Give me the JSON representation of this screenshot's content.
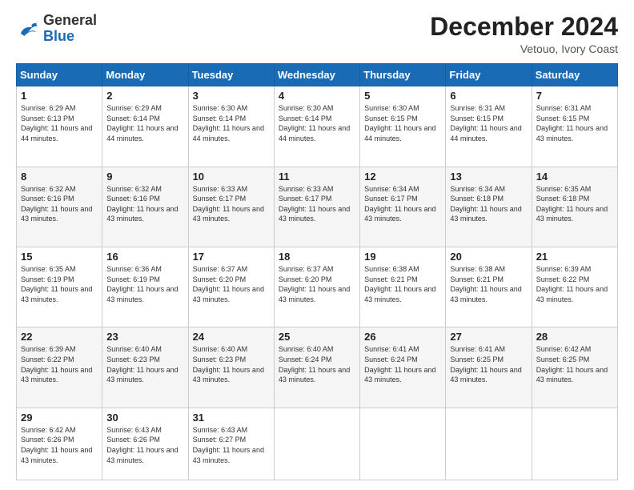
{
  "header": {
    "logo_general": "General",
    "logo_blue": "Blue",
    "month_title": "December 2024",
    "location": "Vetouo, Ivory Coast"
  },
  "days_of_week": [
    "Sunday",
    "Monday",
    "Tuesday",
    "Wednesday",
    "Thursday",
    "Friday",
    "Saturday"
  ],
  "weeks": [
    [
      {
        "day": "1",
        "sunrise": "6:29 AM",
        "sunset": "6:13 PM",
        "daylight": "11 hours and 44 minutes."
      },
      {
        "day": "2",
        "sunrise": "6:29 AM",
        "sunset": "6:14 PM",
        "daylight": "11 hours and 44 minutes."
      },
      {
        "day": "3",
        "sunrise": "6:30 AM",
        "sunset": "6:14 PM",
        "daylight": "11 hours and 44 minutes."
      },
      {
        "day": "4",
        "sunrise": "6:30 AM",
        "sunset": "6:14 PM",
        "daylight": "11 hours and 44 minutes."
      },
      {
        "day": "5",
        "sunrise": "6:30 AM",
        "sunset": "6:15 PM",
        "daylight": "11 hours and 44 minutes."
      },
      {
        "day": "6",
        "sunrise": "6:31 AM",
        "sunset": "6:15 PM",
        "daylight": "11 hours and 44 minutes."
      },
      {
        "day": "7",
        "sunrise": "6:31 AM",
        "sunset": "6:15 PM",
        "daylight": "11 hours and 43 minutes."
      }
    ],
    [
      {
        "day": "8",
        "sunrise": "6:32 AM",
        "sunset": "6:16 PM",
        "daylight": "11 hours and 43 minutes."
      },
      {
        "day": "9",
        "sunrise": "6:32 AM",
        "sunset": "6:16 PM",
        "daylight": "11 hours and 43 minutes."
      },
      {
        "day": "10",
        "sunrise": "6:33 AM",
        "sunset": "6:17 PM",
        "daylight": "11 hours and 43 minutes."
      },
      {
        "day": "11",
        "sunrise": "6:33 AM",
        "sunset": "6:17 PM",
        "daylight": "11 hours and 43 minutes."
      },
      {
        "day": "12",
        "sunrise": "6:34 AM",
        "sunset": "6:17 PM",
        "daylight": "11 hours and 43 minutes."
      },
      {
        "day": "13",
        "sunrise": "6:34 AM",
        "sunset": "6:18 PM",
        "daylight": "11 hours and 43 minutes."
      },
      {
        "day": "14",
        "sunrise": "6:35 AM",
        "sunset": "6:18 PM",
        "daylight": "11 hours and 43 minutes."
      }
    ],
    [
      {
        "day": "15",
        "sunrise": "6:35 AM",
        "sunset": "6:19 PM",
        "daylight": "11 hours and 43 minutes."
      },
      {
        "day": "16",
        "sunrise": "6:36 AM",
        "sunset": "6:19 PM",
        "daylight": "11 hours and 43 minutes."
      },
      {
        "day": "17",
        "sunrise": "6:37 AM",
        "sunset": "6:20 PM",
        "daylight": "11 hours and 43 minutes."
      },
      {
        "day": "18",
        "sunrise": "6:37 AM",
        "sunset": "6:20 PM",
        "daylight": "11 hours and 43 minutes."
      },
      {
        "day": "19",
        "sunrise": "6:38 AM",
        "sunset": "6:21 PM",
        "daylight": "11 hours and 43 minutes."
      },
      {
        "day": "20",
        "sunrise": "6:38 AM",
        "sunset": "6:21 PM",
        "daylight": "11 hours and 43 minutes."
      },
      {
        "day": "21",
        "sunrise": "6:39 AM",
        "sunset": "6:22 PM",
        "daylight": "11 hours and 43 minutes."
      }
    ],
    [
      {
        "day": "22",
        "sunrise": "6:39 AM",
        "sunset": "6:22 PM",
        "daylight": "11 hours and 43 minutes."
      },
      {
        "day": "23",
        "sunrise": "6:40 AM",
        "sunset": "6:23 PM",
        "daylight": "11 hours and 43 minutes."
      },
      {
        "day": "24",
        "sunrise": "6:40 AM",
        "sunset": "6:23 PM",
        "daylight": "11 hours and 43 minutes."
      },
      {
        "day": "25",
        "sunrise": "6:40 AM",
        "sunset": "6:24 PM",
        "daylight": "11 hours and 43 minutes."
      },
      {
        "day": "26",
        "sunrise": "6:41 AM",
        "sunset": "6:24 PM",
        "daylight": "11 hours and 43 minutes."
      },
      {
        "day": "27",
        "sunrise": "6:41 AM",
        "sunset": "6:25 PM",
        "daylight": "11 hours and 43 minutes."
      },
      {
        "day": "28",
        "sunrise": "6:42 AM",
        "sunset": "6:25 PM",
        "daylight": "11 hours and 43 minutes."
      }
    ],
    [
      {
        "day": "29",
        "sunrise": "6:42 AM",
        "sunset": "6:26 PM",
        "daylight": "11 hours and 43 minutes."
      },
      {
        "day": "30",
        "sunrise": "6:43 AM",
        "sunset": "6:26 PM",
        "daylight": "11 hours and 43 minutes."
      },
      {
        "day": "31",
        "sunrise": "6:43 AM",
        "sunset": "6:27 PM",
        "daylight": "11 hours and 43 minutes."
      },
      null,
      null,
      null,
      null
    ]
  ],
  "labels": {
    "sunrise": "Sunrise:",
    "sunset": "Sunset:",
    "daylight": "Daylight:"
  }
}
